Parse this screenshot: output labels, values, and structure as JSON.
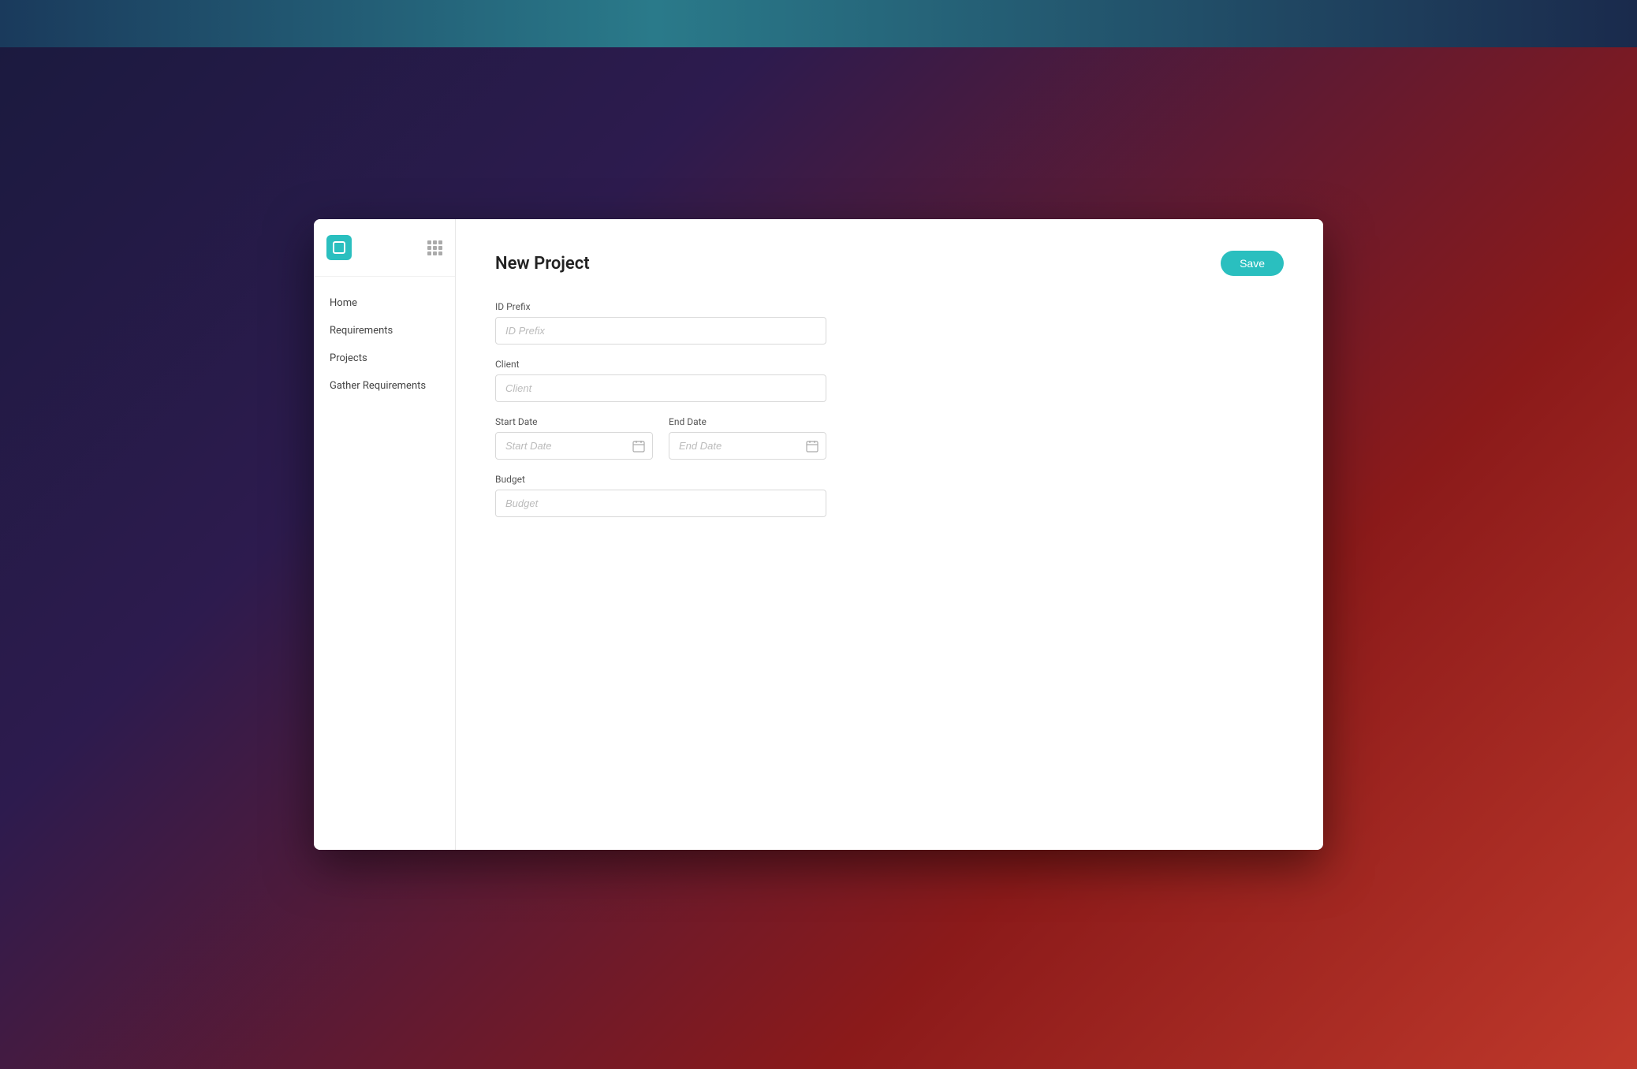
{
  "app": {
    "logo_icon": "box-icon",
    "grid_icon": "grid-icon"
  },
  "sidebar": {
    "items": [
      {
        "label": "Home",
        "id": "home"
      },
      {
        "label": "Requirements",
        "id": "requirements"
      },
      {
        "label": "Projects",
        "id": "projects"
      },
      {
        "label": "Gather Requirements",
        "id": "gather-requirements"
      }
    ]
  },
  "page": {
    "title": "New Project",
    "save_button": "Save"
  },
  "form": {
    "id_prefix": {
      "label": "ID Prefix",
      "placeholder": "ID Prefix"
    },
    "client": {
      "label": "Client",
      "placeholder": "Client"
    },
    "start_date": {
      "label": "Start Date",
      "placeholder": "Start Date"
    },
    "end_date": {
      "label": "End Date",
      "placeholder": "End Date"
    },
    "budget": {
      "label": "Budget",
      "placeholder": "Budget"
    }
  },
  "colors": {
    "accent": "#2abfbf"
  }
}
